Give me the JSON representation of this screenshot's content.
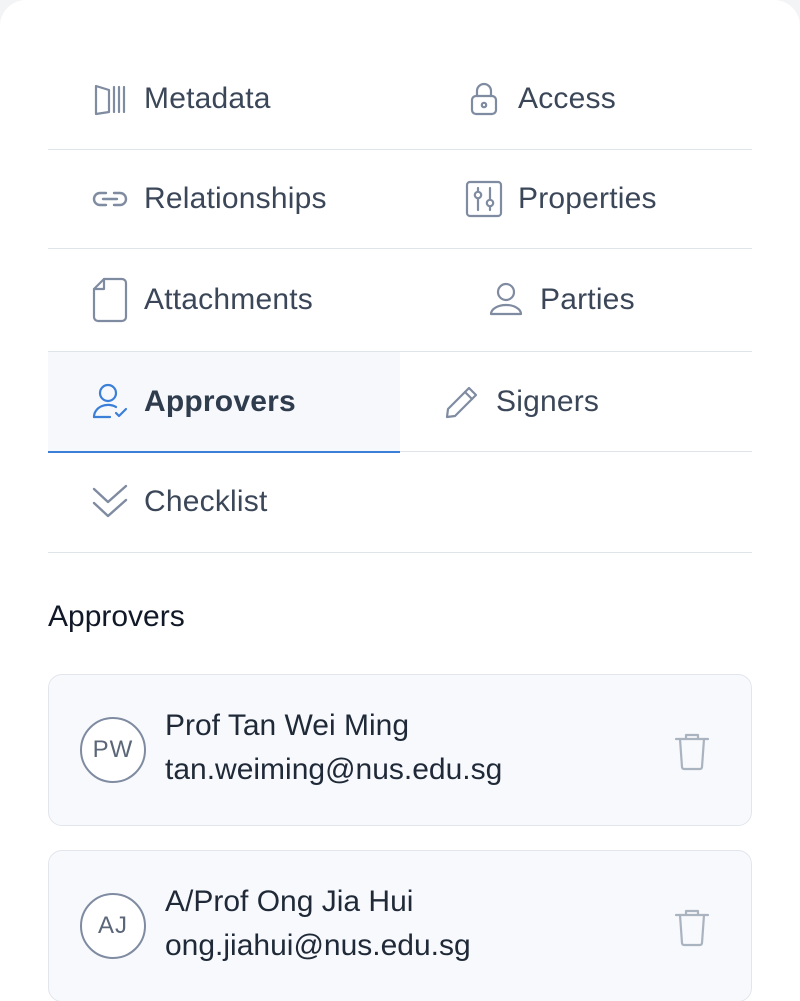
{
  "tabs": {
    "metadata": {
      "label": "Metadata",
      "icon": "metadata-icon"
    },
    "access": {
      "label": "Access",
      "icon": "lock-icon"
    },
    "relationships": {
      "label": "Relationships",
      "icon": "link-icon"
    },
    "properties": {
      "label": "Properties",
      "icon": "sliders-icon"
    },
    "attachments": {
      "label": "Attachments",
      "icon": "file-icon"
    },
    "parties": {
      "label": "Parties",
      "icon": "user-icon"
    },
    "approvers": {
      "label": "Approvers",
      "icon": "user-check-icon",
      "active": true
    },
    "signers": {
      "label": "Signers",
      "icon": "pencil-icon"
    },
    "checklist": {
      "label": "Checklist",
      "icon": "double-check-icon"
    }
  },
  "section": {
    "title": "Approvers"
  },
  "approvers": [
    {
      "initials": "PW",
      "name": "Prof Tan Wei Ming",
      "email": "tan.weiming@nus.edu.sg"
    },
    {
      "initials": "AJ",
      "name": "A/Prof Ong Jia Hui",
      "email": "ong.jiahui@nus.edu.sg"
    }
  ],
  "colors": {
    "accent": "#3b7fd8",
    "icon_muted": "#7f8ba0",
    "text": "#3b4758",
    "divider": "#dfe3ea"
  }
}
